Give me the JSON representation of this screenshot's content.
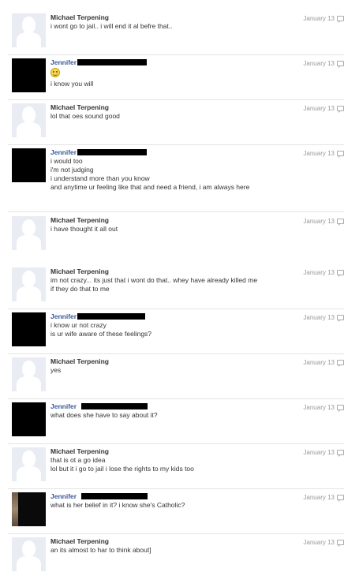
{
  "meta_date": "January 13",
  "messages": [
    {
      "author": "Michael Terpening",
      "lines": [
        "i wont go to jail.. i will end it al befre that.."
      ]
    },
    {
      "author": "Jennifer",
      "lines": [
        "i know you will"
      ]
    },
    {
      "author": "Michael Terpening",
      "lines": [
        "lol that oes sound good"
      ]
    },
    {
      "author": "Jennifer",
      "lines": [
        "i would too",
        "i'm not judging",
        "i understand more than you know",
        "and anytime ur feeling like that and need a friend, i am always here"
      ]
    },
    {
      "author": "Michael Terpening",
      "lines": [
        "i have thought it all out"
      ]
    },
    {
      "author": "Michael Terpening",
      "lines": [
        "im not crazy... its just that i wont do that.. whey have already killed me",
        "if they do that to me"
      ]
    },
    {
      "author": "Jennifer",
      "lines": [
        "i know ur not crazy",
        "is ur wife aware of these feelings?"
      ]
    },
    {
      "author": "Michael Terpening",
      "lines": [
        "yes"
      ]
    },
    {
      "author": "Jennifer",
      "lines": [
        "what does she have to say about it?"
      ]
    },
    {
      "author": "Michael Terpening",
      "lines": [
        "that is ot a go idea",
        "lol but it i go to jail i lose the rights to my kids too"
      ]
    },
    {
      "author": "Jennifer",
      "lines": [
        "what is her belief in it? i know she's Catholic?"
      ]
    },
    {
      "author": "Michael Terpening",
      "lines": [
        "an its almost to har to think about]"
      ]
    }
  ],
  "icons": {
    "reply": "speech-bubble-icon",
    "emoticon": "smiley-emoticon"
  }
}
